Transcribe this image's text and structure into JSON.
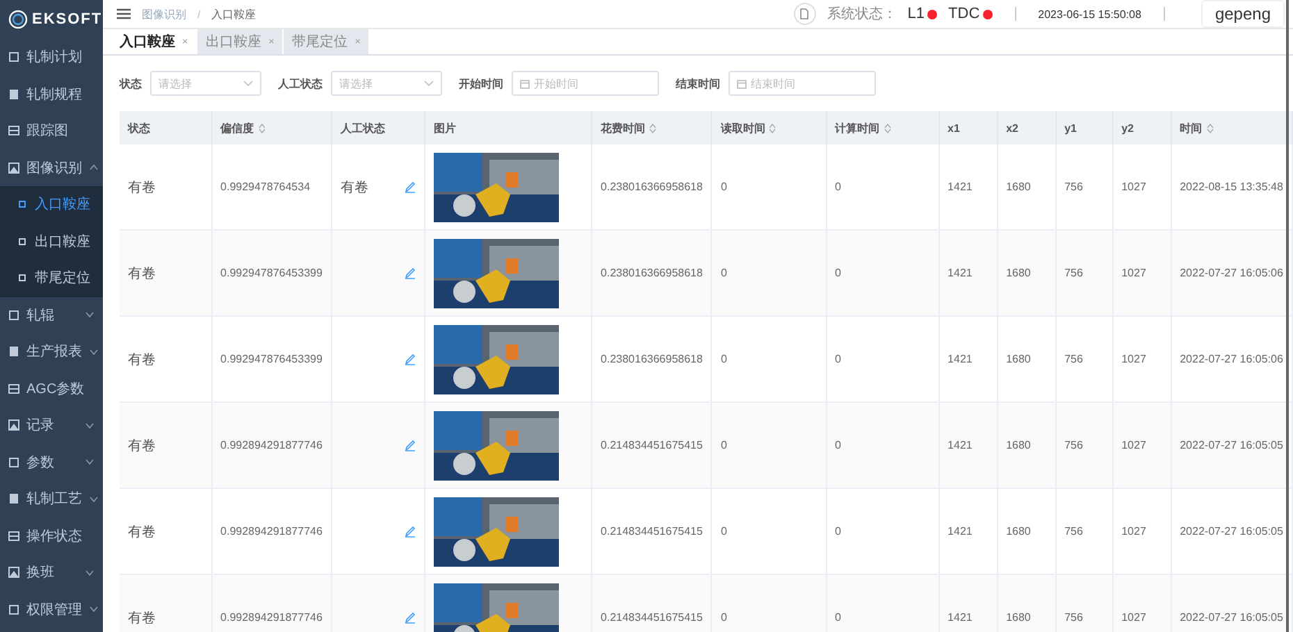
{
  "sidebar": {
    "logo": "EKSOFT",
    "items": [
      {
        "label": "轧制计划",
        "expandable": false
      },
      {
        "label": "轧制规程",
        "expandable": false
      },
      {
        "label": "跟踪图",
        "expandable": false
      },
      {
        "label": "图像识别",
        "expandable": true,
        "expanded": true,
        "children": [
          {
            "label": "入口鞍座",
            "selected": true
          },
          {
            "label": "出口鞍座",
            "selected": false
          },
          {
            "label": "带尾定位",
            "selected": false
          }
        ]
      },
      {
        "label": "轧辊",
        "expandable": true,
        "expanded": false
      },
      {
        "label": "生产报表",
        "expandable": true,
        "expanded": false
      },
      {
        "label": "AGC参数",
        "expandable": false
      },
      {
        "label": "记录",
        "expandable": true,
        "expanded": false
      },
      {
        "label": "参数",
        "expandable": true,
        "expanded": false
      },
      {
        "label": "轧制工艺",
        "expandable": true,
        "expanded": false
      },
      {
        "label": "操作状态",
        "expandable": false
      },
      {
        "label": "换班",
        "expandable": true,
        "expanded": false
      },
      {
        "label": "权限管理",
        "expandable": true,
        "expanded": false
      }
    ]
  },
  "header": {
    "breadcrumb": [
      "图像识别",
      "入口鞍座"
    ],
    "breadcrumb_separator": "/",
    "status_label": "系统状态：",
    "indicators": [
      {
        "label": "L1",
        "online": false
      },
      {
        "label": "TDC",
        "online": false
      }
    ],
    "datetime": "2023-06-15 15:50:08",
    "user": "gepeng"
  },
  "tabs": [
    {
      "label": "入口鞍座",
      "close": "×",
      "selected": true
    },
    {
      "label": "出口鞍座",
      "close": "×",
      "selected": false
    },
    {
      "label": "带尾定位",
      "close": "×",
      "selected": false
    }
  ],
  "filters": [
    {
      "label": "状态",
      "kind": "select",
      "placeholder": "请选择"
    },
    {
      "label": "人工状态",
      "kind": "select",
      "placeholder": "请选择"
    },
    {
      "label": "开始时间",
      "kind": "date",
      "placeholder": "开始时间"
    },
    {
      "label": "结束时间",
      "kind": "date",
      "placeholder": "结束时间"
    }
  ],
  "table": {
    "columns": [
      {
        "label": "状态",
        "kind": "text",
        "sortable": false
      },
      {
        "label": "偏信度",
        "kind": "text",
        "sortable": true
      },
      {
        "label": "人工状态",
        "kind": "manual",
        "sortable": false
      },
      {
        "label": "图片",
        "kind": "photo",
        "sortable": false
      },
      {
        "label": "花费时间",
        "kind": "text",
        "sortable": true
      },
      {
        "label": "读取时间",
        "kind": "text",
        "sortable": true
      },
      {
        "label": "计算时间",
        "kind": "text",
        "sortable": true
      },
      {
        "label": "x1",
        "kind": "text",
        "sortable": false
      },
      {
        "label": "x2",
        "kind": "text",
        "sortable": false
      },
      {
        "label": "y1",
        "kind": "text",
        "sortable": false
      },
      {
        "label": "y2",
        "kind": "text",
        "sortable": false
      },
      {
        "label": "时间",
        "kind": "text",
        "sortable": true
      }
    ],
    "rows": [
      {
        "cells": [
          "有卷",
          "0.9929478764534",
          "有卷",
          "",
          "0.238016366958618",
          "0",
          "0",
          "1421",
          "1680",
          "756",
          "1027",
          "2022-08-15 13:35:48"
        ]
      },
      {
        "cells": [
          "有卷",
          "0.992947876453399",
          "",
          "",
          "0.238016366958618",
          "0",
          "0",
          "1421",
          "1680",
          "756",
          "1027",
          "2022-07-27 16:05:06"
        ]
      },
      {
        "cells": [
          "有卷",
          "0.992947876453399",
          "",
          "",
          "0.238016366958618",
          "0",
          "0",
          "1421",
          "1680",
          "756",
          "1027",
          "2022-07-27 16:05:06"
        ]
      },
      {
        "cells": [
          "有卷",
          "0.992894291877746",
          "",
          "",
          "0.214834451675415",
          "0",
          "0",
          "1421",
          "1680",
          "756",
          "1027",
          "2022-07-27 16:05:05"
        ]
      },
      {
        "cells": [
          "有卷",
          "0.992894291877746",
          "",
          "",
          "0.214834451675415",
          "0",
          "0",
          "1421",
          "1680",
          "756",
          "1027",
          "2022-07-27 16:05:05"
        ]
      },
      {
        "cells": [
          "有卷",
          "0.992894291877746",
          "",
          "",
          "0.214834451675415",
          "0",
          "0",
          "1421",
          "1680",
          "756",
          "1027",
          "2022-07-27 16:05:05"
        ]
      }
    ]
  }
}
